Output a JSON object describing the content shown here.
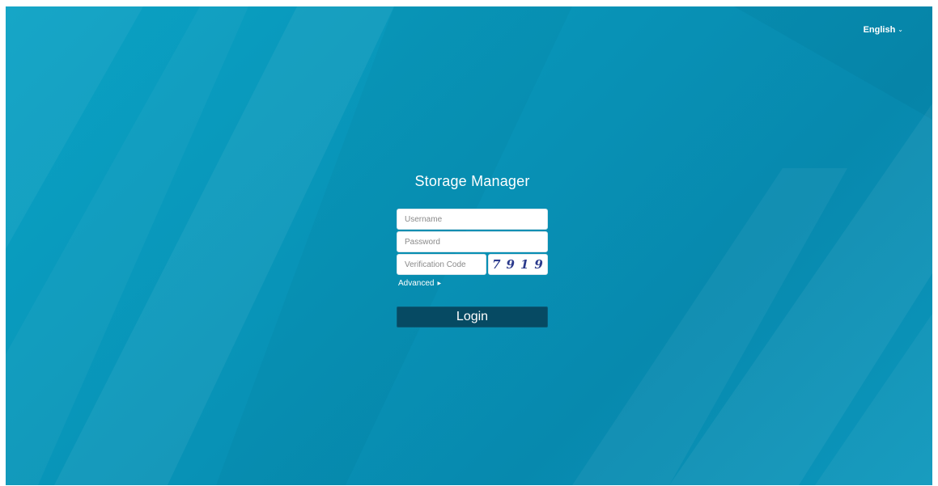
{
  "language": {
    "selected": "English"
  },
  "login": {
    "title": "Storage Manager",
    "username_placeholder": "Username",
    "password_placeholder": "Password",
    "verification_placeholder": "Verification Code",
    "captcha_code": "7919",
    "advanced_label": "Advanced",
    "login_label": "Login"
  },
  "icons": {
    "language_dropdown": "chevron-down-icon",
    "advanced_expand": "triangle-right-icon"
  },
  "colors": {
    "background_primary": "#0892b6",
    "background_light": "#0aa2c4",
    "login_button": "#064a63",
    "captcha_text": "#2b3a8c"
  }
}
